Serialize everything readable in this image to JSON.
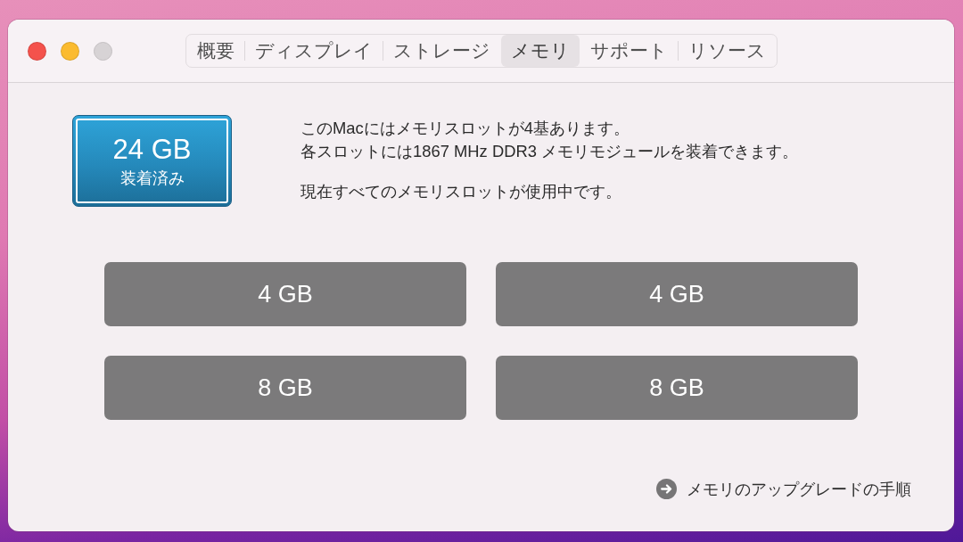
{
  "window": {
    "controls": [
      {
        "kind": "close",
        "disabled": false
      },
      {
        "kind": "minimize",
        "disabled": false
      },
      {
        "kind": "zoom",
        "disabled": true
      }
    ]
  },
  "tabs": [
    {
      "label": "概要",
      "selected": false
    },
    {
      "label": "ディスプレイ",
      "selected": false
    },
    {
      "label": "ストレージ",
      "selected": false
    },
    {
      "label": "メモリ",
      "selected": true
    },
    {
      "label": "サポート",
      "selected": false
    },
    {
      "label": "リソース",
      "selected": false
    }
  ],
  "summary": {
    "capacity": "24 GB",
    "caption": "装着済み"
  },
  "paragraphs": [
    {
      "lines": [
        "このMacにはメモリスロットが4基あります。",
        "各スロットには1867 MHz DDR3 メモリモジュールを装着できます。"
      ]
    },
    {
      "lines": [
        "現在すべてのメモリスロットが使用中です。"
      ]
    }
  ],
  "slots": [
    "4 GB",
    "4 GB",
    "8 GB",
    "8 GB"
  ],
  "footer_link": {
    "label": "メモリのアップグレードの手順"
  }
}
